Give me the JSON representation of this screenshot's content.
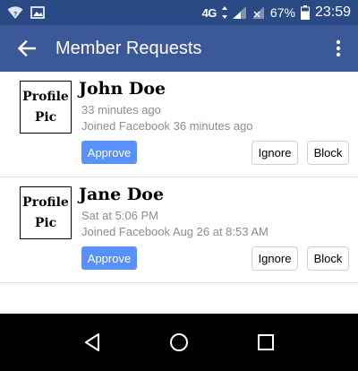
{
  "status_bar": {
    "network": "4G",
    "battery": "67%",
    "time": "23:59"
  },
  "app_bar": {
    "title": "Member Requests"
  },
  "requests": [
    {
      "pic_line1": "Profile",
      "pic_line2": "Pic",
      "name": "John Doe",
      "time": "33 minutes ago",
      "joined": "Joined Facebook 36 minutes ago",
      "approve_label": "Approve",
      "ignore_label": "Ignore",
      "block_label": "Block"
    },
    {
      "pic_line1": "Profile",
      "pic_line2": "Pic",
      "name": "Jane Doe",
      "time": "Sat at 5:06 PM",
      "joined": "Joined Facebook Aug 26 at 8:53 AM",
      "approve_label": "Approve",
      "ignore_label": "Ignore",
      "block_label": "Block"
    }
  ],
  "colors": {
    "status_bar": "#2a4a86",
    "app_bar": "#3b5998",
    "approve": "#5890ff",
    "meta_text": "#8a8d91"
  }
}
